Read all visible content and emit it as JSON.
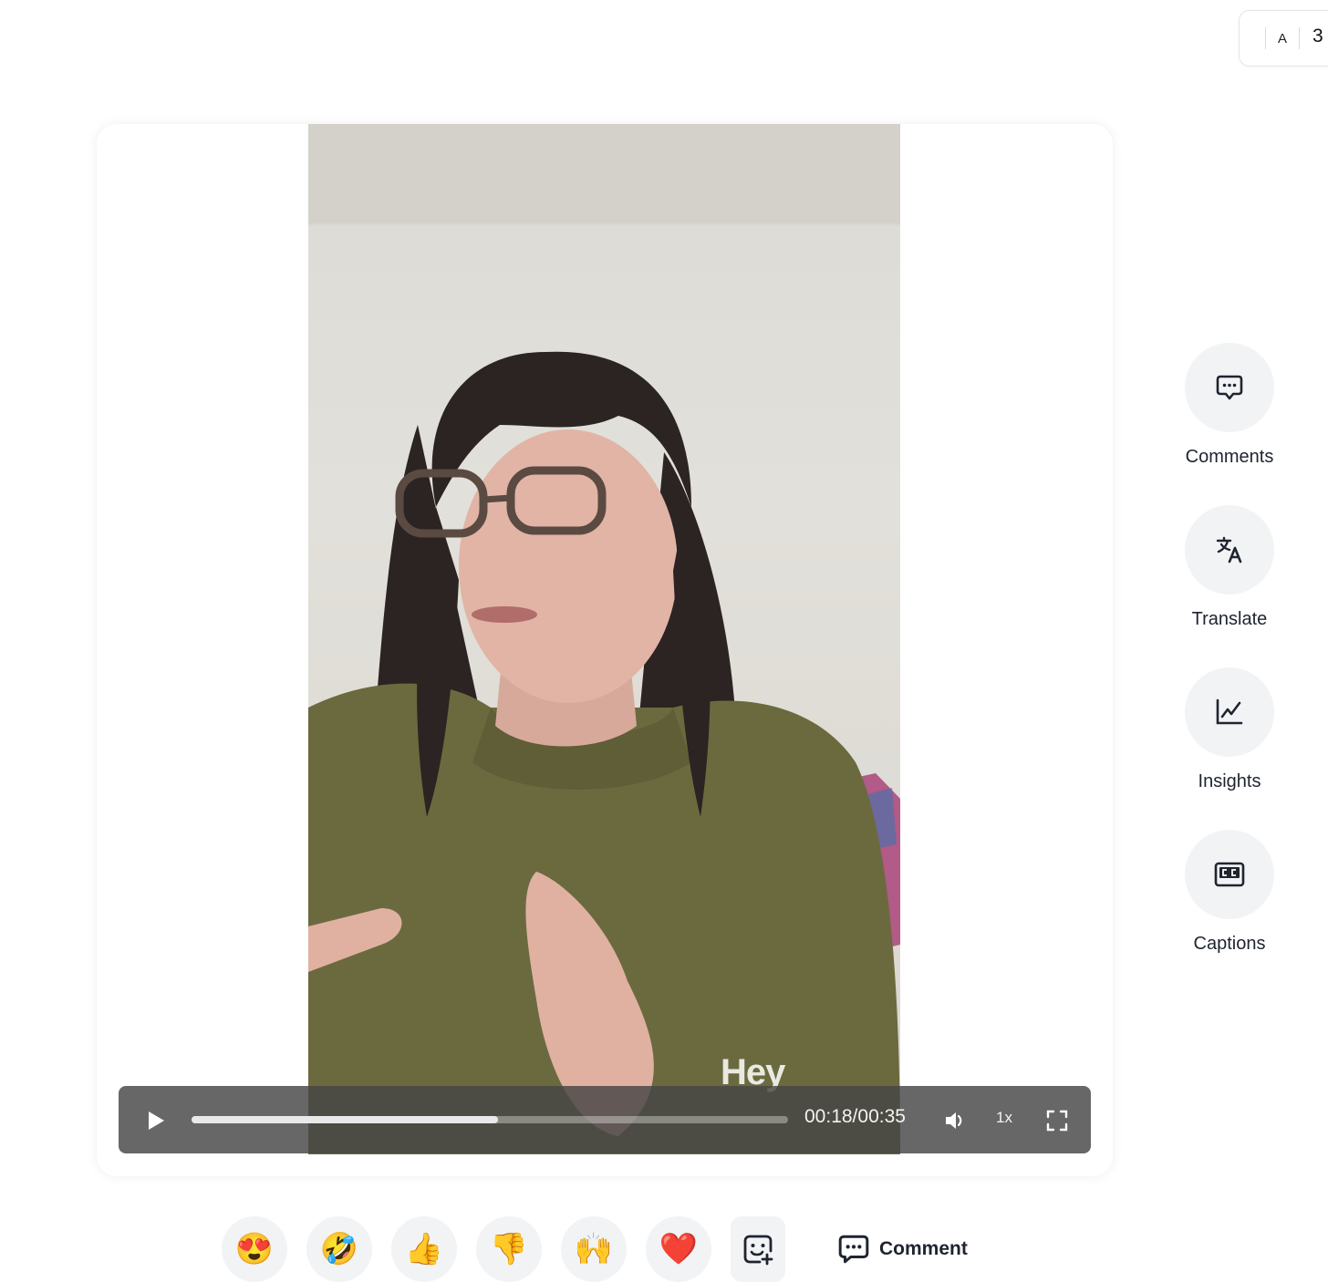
{
  "header": {
    "language_chip": {
      "avatar_letter": "A",
      "count": "3"
    }
  },
  "player": {
    "watermark": "Hey",
    "controls": {
      "current_time": "00:18",
      "duration": "00:35",
      "time_text": "00:18/00:35",
      "progress_fraction": 0.514,
      "speed_label": "1x",
      "icons": [
        "play-icon",
        "volume-icon",
        "fullscreen-icon"
      ]
    }
  },
  "side_actions": [
    {
      "label": "Comments",
      "icon": "comment-bubble-icon"
    },
    {
      "label": "Translate",
      "icon": "translate-icon"
    },
    {
      "label": "Insights",
      "icon": "chart-line-icon"
    },
    {
      "label": "Captions",
      "icon": "closed-captions-icon"
    }
  ],
  "reactions": [
    {
      "emoji": "😍",
      "name": "heart-eyes"
    },
    {
      "emoji": "🤣",
      "name": "rolling-laughing"
    },
    {
      "emoji": "👍",
      "name": "thumbs-up"
    },
    {
      "emoji": "👎",
      "name": "thumbs-down"
    },
    {
      "emoji": "🙌",
      "name": "raised-hands"
    },
    {
      "emoji": "❤️",
      "name": "red-heart"
    }
  ],
  "comment_button": {
    "label": "Comment",
    "icon": "comment-bubble-icon"
  },
  "colors": {
    "background": "#ffffff",
    "circle_bg": "#f2f3f5",
    "text": "#1f2430",
    "controls_bg": "#464646"
  }
}
